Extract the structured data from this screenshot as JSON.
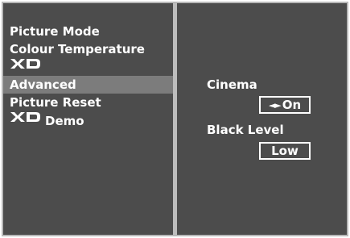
{
  "menu": {
    "items": [
      {
        "label": "Picture Mode"
      },
      {
        "label": "Colour Temperature"
      },
      {
        "label": "XD"
      },
      {
        "label": "Advanced",
        "selected": true
      },
      {
        "label": "Picture Reset"
      },
      {
        "label": "XD",
        "suffix": "Demo"
      }
    ]
  },
  "options": {
    "cinema": {
      "label": "Cinema",
      "value": "On",
      "arrows": "◄►"
    },
    "black_level": {
      "label": "Black Level",
      "value": "Low"
    }
  },
  "colors": {
    "panel": "#4c4c4c",
    "selected": "#7c7c7c",
    "divider": "#bdbdbd",
    "text": "#ffffff"
  }
}
